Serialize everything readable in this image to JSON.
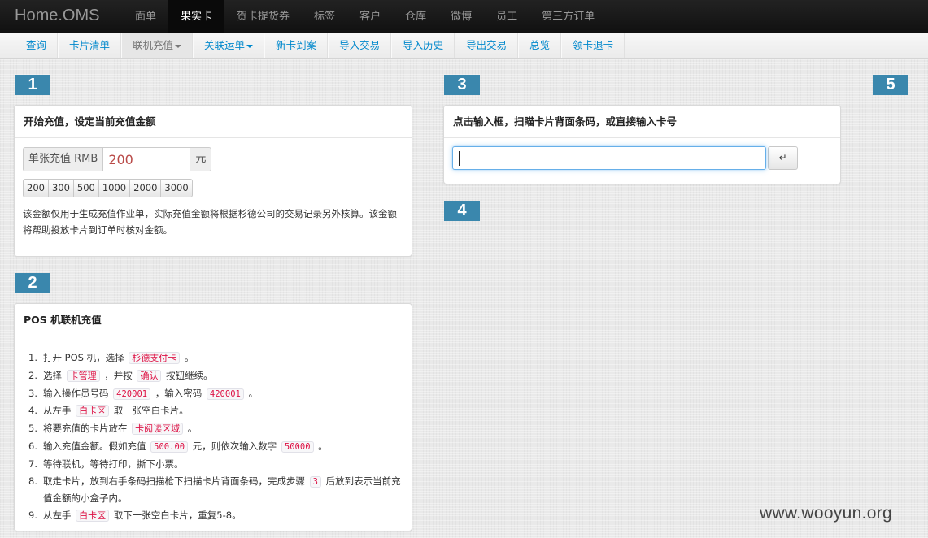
{
  "brand": "Home.OMS",
  "topnav": [
    {
      "label": "面单"
    },
    {
      "label": "果实卡",
      "active": true
    },
    {
      "label": "贺卡提货券"
    },
    {
      "label": "标签"
    },
    {
      "label": "客户"
    },
    {
      "label": "仓库"
    },
    {
      "label": "微博"
    },
    {
      "label": "员工"
    },
    {
      "label": "第三方订单"
    }
  ],
  "subnav": [
    {
      "label": "查询"
    },
    {
      "label": "卡片清单"
    },
    {
      "label": "联机充值",
      "dropdown": true,
      "muted": true
    },
    {
      "label": "关联运单",
      "dropdown": true
    },
    {
      "label": "新卡到案"
    },
    {
      "label": "导入交易"
    },
    {
      "label": "导入历史"
    },
    {
      "label": "导出交易"
    },
    {
      "label": "总览"
    },
    {
      "label": "领卡退卡"
    }
  ],
  "badges": {
    "b1": "1",
    "b2": "2",
    "b3": "3",
    "b4": "4",
    "b5": "5"
  },
  "panel1": {
    "title": "开始充值，设定当前充值金额",
    "prefix": "单张充值 RMB",
    "amount": "200",
    "suffix": "元",
    "presets": [
      "200",
      "300",
      "500",
      "1000",
      "2000",
      "3000"
    ],
    "note": "该金额仅用于生成充值作业单，实际充值金额将根据杉德公司的交易记录另外核算。该金额将帮助投放卡片到订单时核对金额。"
  },
  "panel2": {
    "title": "POS 机联机充值",
    "steps": [
      {
        "num": "1.",
        "parts": [
          {
            "t": "打开 POS 机，选择 "
          },
          {
            "c": "杉德支付卡"
          },
          {
            "t": " 。"
          }
        ]
      },
      {
        "num": "2.",
        "parts": [
          {
            "t": "选择 "
          },
          {
            "c": "卡管理"
          },
          {
            "t": " ，并按 "
          },
          {
            "c": "确认"
          },
          {
            "t": " 按钮继续。"
          }
        ]
      },
      {
        "num": "3.",
        "parts": [
          {
            "t": "输入操作员号码 "
          },
          {
            "c": "420001",
            "mono": true
          },
          {
            "t": " ，输入密码 "
          },
          {
            "c": "420001",
            "mono": true
          },
          {
            "t": " 。"
          }
        ]
      },
      {
        "num": "4.",
        "parts": [
          {
            "t": "从左手 "
          },
          {
            "c": "白卡区"
          },
          {
            "t": " 取一张空白卡片。"
          }
        ]
      },
      {
        "num": "5.",
        "parts": [
          {
            "t": "将要充值的卡片放在 "
          },
          {
            "c": "卡阅读区域"
          },
          {
            "t": " 。"
          }
        ]
      },
      {
        "num": "6.",
        "parts": [
          {
            "t": "输入充值金额。假如充值 "
          },
          {
            "c": "500.00",
            "mono": true
          },
          {
            "t": " 元，则依次输入数字 "
          },
          {
            "c": "50000",
            "mono": true
          },
          {
            "t": " 。"
          }
        ]
      },
      {
        "num": "7.",
        "parts": [
          {
            "t": "等待联机，等待打印，撕下小票。"
          }
        ]
      },
      {
        "num": "8.",
        "parts": [
          {
            "t": "取走卡片，放到右手条码扫描枪下扫描卡片背面条码，完成步骤 "
          },
          {
            "c": "3",
            "mono": true
          },
          {
            "t": " 后放到表示当前充值金额的小盒子内。"
          }
        ]
      },
      {
        "num": "9.",
        "parts": [
          {
            "t": "从左手 "
          },
          {
            "c": "白卡区"
          },
          {
            "t": " 取下一张空白卡片，重复5-8。"
          }
        ]
      }
    ]
  },
  "panel3": {
    "title": "点击输入框，扫瞄卡片背面条码，或直接输入卡号",
    "scan_value": "",
    "go_label": "↵"
  },
  "watermark": "www.wooyun.org"
}
